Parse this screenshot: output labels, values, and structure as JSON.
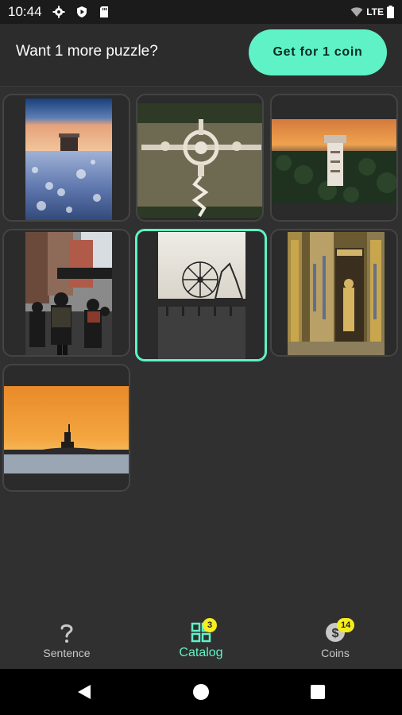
{
  "status_bar": {
    "time": "10:44",
    "left_icons": [
      "gear-icon",
      "play-protect-icon",
      "sd-card-icon"
    ],
    "network": "LTE",
    "right_icons": [
      "wifi-icon",
      "battery-icon"
    ]
  },
  "promo": {
    "text": "Want 1 more puzzle?",
    "button_label": "Get for 1 coin"
  },
  "puzzles": [
    {
      "subject": "snowy-coastline",
      "selected": false
    },
    {
      "subject": "palace-on-lake",
      "selected": false
    },
    {
      "subject": "tower-in-forest",
      "selected": false
    },
    {
      "subject": "city-street-crowd",
      "selected": false
    },
    {
      "subject": "pier-ferris-wheel",
      "selected": true
    },
    {
      "subject": "golden-temple",
      "selected": false
    },
    {
      "subject": "statue-of-liberty-sunset",
      "selected": false
    }
  ],
  "bottom_nav": {
    "items": [
      {
        "label": "Sentence",
        "icon": "question-icon",
        "active": false
      },
      {
        "label": "Catalog",
        "icon": "grid-icon",
        "badge": "3",
        "active": true
      },
      {
        "label": "Coins",
        "icon": "dollar-coin-icon",
        "badge": "14",
        "active": false
      }
    ]
  },
  "colors": {
    "accent": "#5ef2c6",
    "badge": "#f6ee1a",
    "background": "#303030"
  }
}
